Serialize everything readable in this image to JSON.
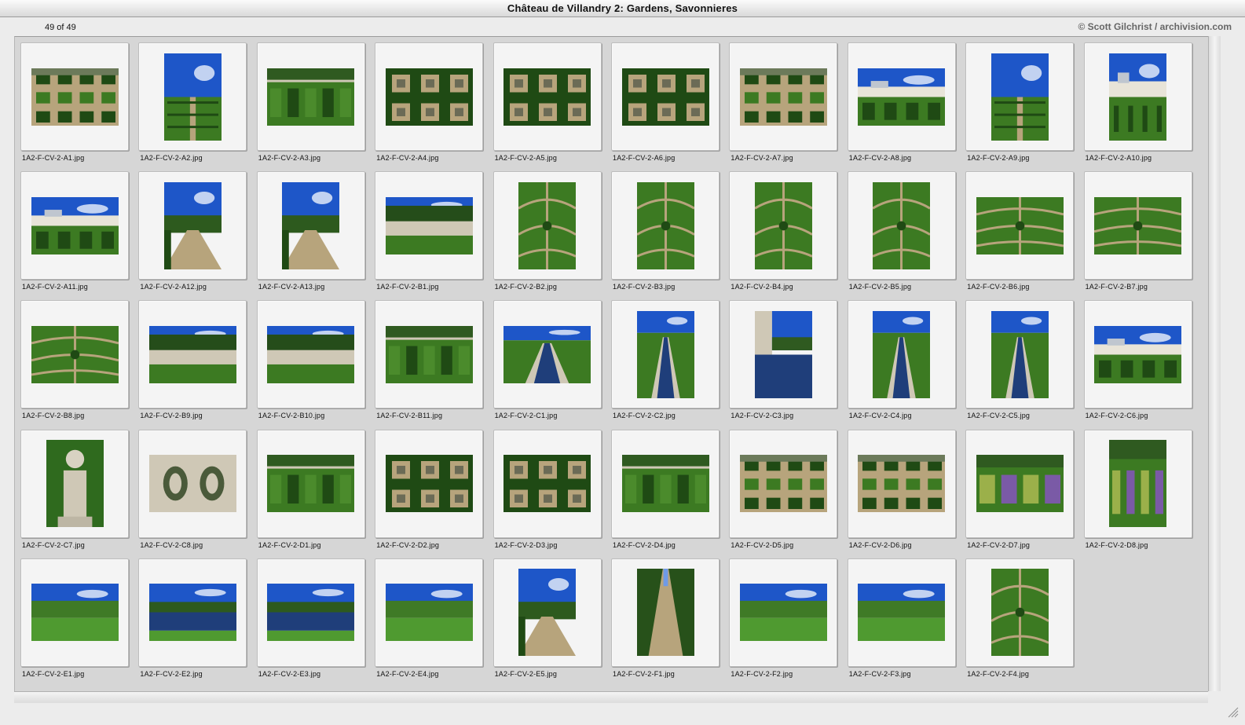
{
  "window": {
    "title": "Château de Villandry 2: Gardens, Savonnieres"
  },
  "infobar": {
    "count": "49 of 49",
    "credit": "© Scott Gilchrist / archivision.com"
  },
  "colors": {
    "sky": "#1e56c8",
    "sky_light": "#6f9ae6",
    "hedge_dark": "#1f4a14",
    "hedge": "#3c7a22",
    "gravel": "#b7a47c",
    "water": "#1f3e7a",
    "stone": "#cfc8b6",
    "lavender": "#7a5aa6"
  },
  "thumbnails": [
    {
      "file": "1A2-F-CV-2-A1.jpg",
      "orientation": "landscape",
      "scene": "parterre-aerial"
    },
    {
      "file": "1A2-F-CV-2-A2.jpg",
      "orientation": "portrait",
      "scene": "sky-parterre"
    },
    {
      "file": "1A2-F-CV-2-A3.jpg",
      "orientation": "landscape",
      "scene": "parterre-wall"
    },
    {
      "file": "1A2-F-CV-2-A4.jpg",
      "orientation": "landscape",
      "scene": "parterre-grid"
    },
    {
      "file": "1A2-F-CV-2-A5.jpg",
      "orientation": "landscape",
      "scene": "parterre-grid"
    },
    {
      "file": "1A2-F-CV-2-A6.jpg",
      "orientation": "landscape",
      "scene": "parterre-grid"
    },
    {
      "file": "1A2-F-CV-2-A7.jpg",
      "orientation": "landscape",
      "scene": "parterre-aerial"
    },
    {
      "file": "1A2-F-CV-2-A8.jpg",
      "orientation": "landscape",
      "scene": "chateau"
    },
    {
      "file": "1A2-F-CV-2-A9.jpg",
      "orientation": "portrait",
      "scene": "sky-parterre"
    },
    {
      "file": "1A2-F-CV-2-A10.jpg",
      "orientation": "portrait",
      "scene": "chateau"
    },
    {
      "file": "1A2-F-CV-2-A11.jpg",
      "orientation": "landscape",
      "scene": "chateau"
    },
    {
      "file": "1A2-F-CV-2-A12.jpg",
      "orientation": "portrait",
      "scene": "path"
    },
    {
      "file": "1A2-F-CV-2-A13.jpg",
      "orientation": "portrait",
      "scene": "path"
    },
    {
      "file": "1A2-F-CV-2-B1.jpg",
      "orientation": "landscape",
      "scene": "wall-trees"
    },
    {
      "file": "1A2-F-CV-2-B2.jpg",
      "orientation": "portrait",
      "scene": "maze"
    },
    {
      "file": "1A2-F-CV-2-B3.jpg",
      "orientation": "portrait",
      "scene": "maze"
    },
    {
      "file": "1A2-F-CV-2-B4.jpg",
      "orientation": "portrait",
      "scene": "maze"
    },
    {
      "file": "1A2-F-CV-2-B5.jpg",
      "orientation": "portrait",
      "scene": "maze"
    },
    {
      "file": "1A2-F-CV-2-B6.jpg",
      "orientation": "landscape",
      "scene": "maze"
    },
    {
      "file": "1A2-F-CV-2-B7.jpg",
      "orientation": "landscape",
      "scene": "maze"
    },
    {
      "file": "1A2-F-CV-2-B8.jpg",
      "orientation": "landscape",
      "scene": "maze"
    },
    {
      "file": "1A2-F-CV-2-B9.jpg",
      "orientation": "landscape",
      "scene": "wall-trees"
    },
    {
      "file": "1A2-F-CV-2-B10.jpg",
      "orientation": "landscape",
      "scene": "wall-trees"
    },
    {
      "file": "1A2-F-CV-2-B11.jpg",
      "orientation": "landscape",
      "scene": "parterre-wall"
    },
    {
      "file": "1A2-F-CV-2-C1.jpg",
      "orientation": "landscape",
      "scene": "canal"
    },
    {
      "file": "1A2-F-CV-2-C2.jpg",
      "orientation": "portrait",
      "scene": "canal"
    },
    {
      "file": "1A2-F-CV-2-C3.jpg",
      "orientation": "portrait",
      "scene": "water-wall"
    },
    {
      "file": "1A2-F-CV-2-C4.jpg",
      "orientation": "portrait",
      "scene": "canal"
    },
    {
      "file": "1A2-F-CV-2-C5.jpg",
      "orientation": "portrait",
      "scene": "canal"
    },
    {
      "file": "1A2-F-CV-2-C6.jpg",
      "orientation": "landscape",
      "scene": "chateau"
    },
    {
      "file": "1A2-F-CV-2-C7.jpg",
      "orientation": "portrait",
      "scene": "finial"
    },
    {
      "file": "1A2-F-CV-2-C8.jpg",
      "orientation": "landscape",
      "scene": "balustrade"
    },
    {
      "file": "1A2-F-CV-2-D1.jpg",
      "orientation": "landscape",
      "scene": "parterre-wall"
    },
    {
      "file": "1A2-F-CV-2-D2.jpg",
      "orientation": "landscape",
      "scene": "parterre-grid"
    },
    {
      "file": "1A2-F-CV-2-D3.jpg",
      "orientation": "landscape",
      "scene": "parterre-grid"
    },
    {
      "file": "1A2-F-CV-2-D4.jpg",
      "orientation": "landscape",
      "scene": "parterre-wall"
    },
    {
      "file": "1A2-F-CV-2-D5.jpg",
      "orientation": "landscape",
      "scene": "parterre-aerial"
    },
    {
      "file": "1A2-F-CV-2-D6.jpg",
      "orientation": "landscape",
      "scene": "parterre-aerial"
    },
    {
      "file": "1A2-F-CV-2-D7.jpg",
      "orientation": "landscape",
      "scene": "lavender"
    },
    {
      "file": "1A2-F-CV-2-D8.jpg",
      "orientation": "portrait",
      "scene": "lavender"
    },
    {
      "file": "1A2-F-CV-2-E1.jpg",
      "orientation": "landscape",
      "scene": "lawn-sky"
    },
    {
      "file": "1A2-F-CV-2-E2.jpg",
      "orientation": "landscape",
      "scene": "pond"
    },
    {
      "file": "1A2-F-CV-2-E3.jpg",
      "orientation": "landscape",
      "scene": "pond"
    },
    {
      "file": "1A2-F-CV-2-E4.jpg",
      "orientation": "landscape",
      "scene": "lawn-sky"
    },
    {
      "file": "1A2-F-CV-2-E5.jpg",
      "orientation": "portrait",
      "scene": "path"
    },
    {
      "file": "1A2-F-CV-2-F1.jpg",
      "orientation": "portrait",
      "scene": "allee"
    },
    {
      "file": "1A2-F-CV-2-F2.jpg",
      "orientation": "landscape",
      "scene": "lawn-sky"
    },
    {
      "file": "1A2-F-CV-2-F3.jpg",
      "orientation": "landscape",
      "scene": "lawn-sky"
    },
    {
      "file": "1A2-F-CV-2-F4.jpg",
      "orientation": "portrait",
      "scene": "maze"
    }
  ]
}
